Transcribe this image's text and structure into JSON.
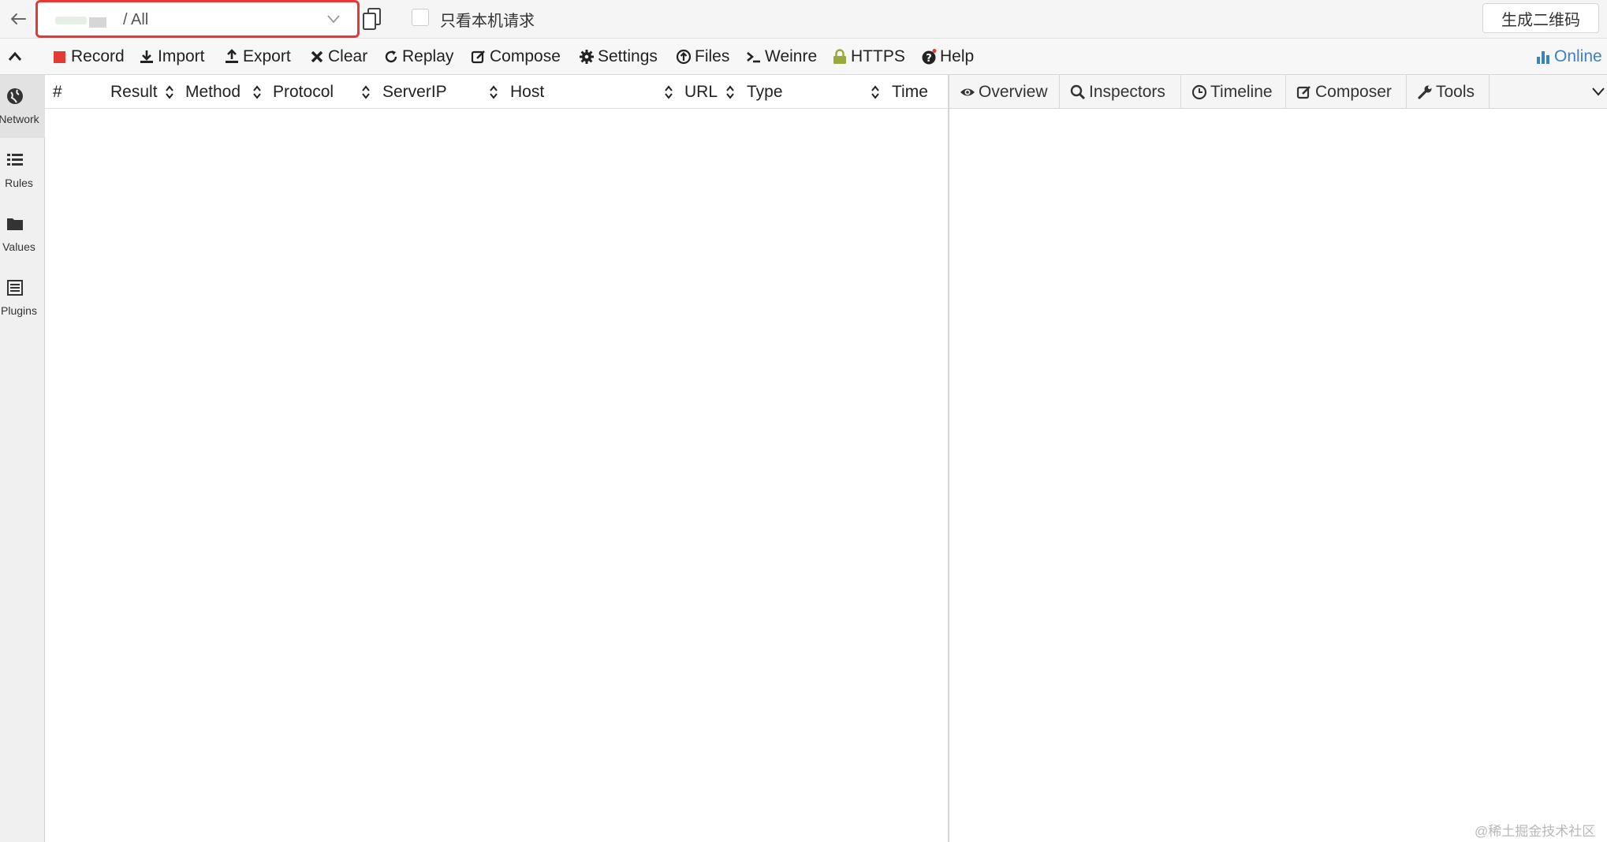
{
  "topbar": {
    "env_text": "/ All",
    "checkbox_label": "只看本机请求",
    "qr_button": "生成二维码"
  },
  "menu": [
    {
      "id": "record",
      "label": "Record",
      "icon": "record-icon"
    },
    {
      "id": "import",
      "label": "Import",
      "icon": "import-icon"
    },
    {
      "id": "export",
      "label": "Export",
      "icon": "export-icon"
    },
    {
      "id": "clear",
      "label": "Clear",
      "icon": "clear-icon"
    },
    {
      "id": "replay",
      "label": "Replay",
      "icon": "replay-icon"
    },
    {
      "id": "compose",
      "label": "Compose",
      "icon": "compose-icon"
    },
    {
      "id": "settings",
      "label": "Settings",
      "icon": "gear-icon"
    },
    {
      "id": "files",
      "label": "Files",
      "icon": "upload-icon"
    },
    {
      "id": "weinre",
      "label": "Weinre",
      "icon": "terminal-icon"
    },
    {
      "id": "https",
      "label": "HTTPS",
      "icon": "lock-icon"
    },
    {
      "id": "help",
      "label": "Help",
      "icon": "question-icon"
    },
    {
      "id": "online",
      "label": "Online",
      "icon": "bar-chart-icon"
    }
  ],
  "sidebar": [
    {
      "label": "Network",
      "icon": "globe-icon"
    },
    {
      "label": "Rules",
      "icon": "list-icon"
    },
    {
      "label": "Values",
      "icon": "folder-icon"
    },
    {
      "label": "Plugins",
      "icon": "plugins-icon"
    }
  ],
  "columns": [
    "#",
    "Result",
    "Method",
    "Protocol",
    "ServerIP",
    "Host",
    "URL",
    "Type",
    "Time"
  ],
  "tabs": [
    {
      "label": "Overview",
      "icon": "eye-icon"
    },
    {
      "label": "Inspectors",
      "icon": "search-icon"
    },
    {
      "label": "Timeline",
      "icon": "clock-icon"
    },
    {
      "label": "Composer",
      "icon": "edit-icon"
    },
    {
      "label": "Tools",
      "icon": "wrench-icon"
    }
  ],
  "watermark": "@稀土掘金技术社区",
  "colors": {
    "accent": "#3b82c4",
    "record": "#e53935",
    "highlight_border": "#e53935",
    "https": "#9aa83c"
  }
}
